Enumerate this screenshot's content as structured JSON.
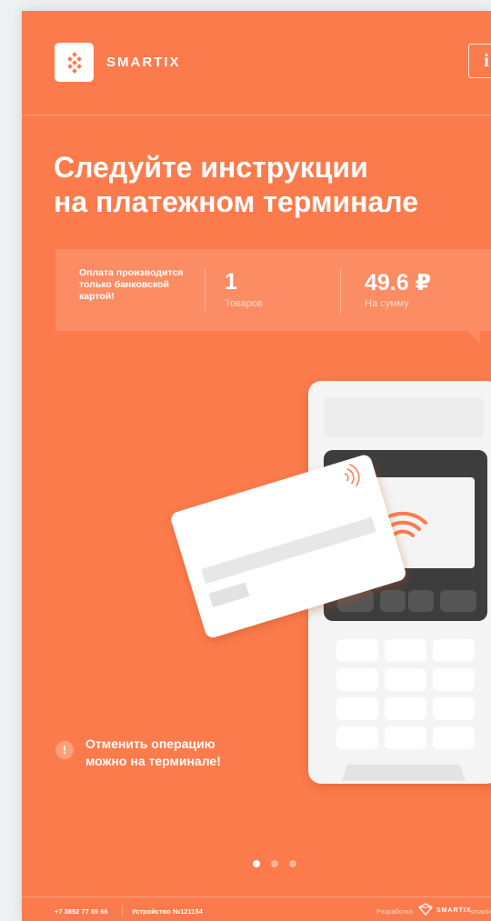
{
  "brand": {
    "name": "SMARTIX"
  },
  "header": {
    "info_label": "i"
  },
  "title": {
    "line1": "Следуйте инструкции",
    "line2": "на платежном терминале"
  },
  "summary": {
    "note": "Оплата производится только банковской картой!",
    "items_count": "1",
    "items_label": "Товаров",
    "amount": "49.6 ₽",
    "amount_label": "На сумму"
  },
  "cancel": {
    "icon": "!",
    "text": "Отменить операцию можно на терминале!"
  },
  "pagination": {
    "total": 3,
    "active": 0
  },
  "footer": {
    "phone": "+7 3852 77 89 66",
    "device": "Устройство №121154",
    "developed_by": "Разработка",
    "dev_brand": "SMARTIX",
    "dev_tail": "smartix"
  },
  "colors": {
    "background": "#fc7b4c",
    "terminal_body": "#f4f4f4",
    "terminal_screen": "#3d3d3d",
    "accent": "#fc7b4c"
  }
}
